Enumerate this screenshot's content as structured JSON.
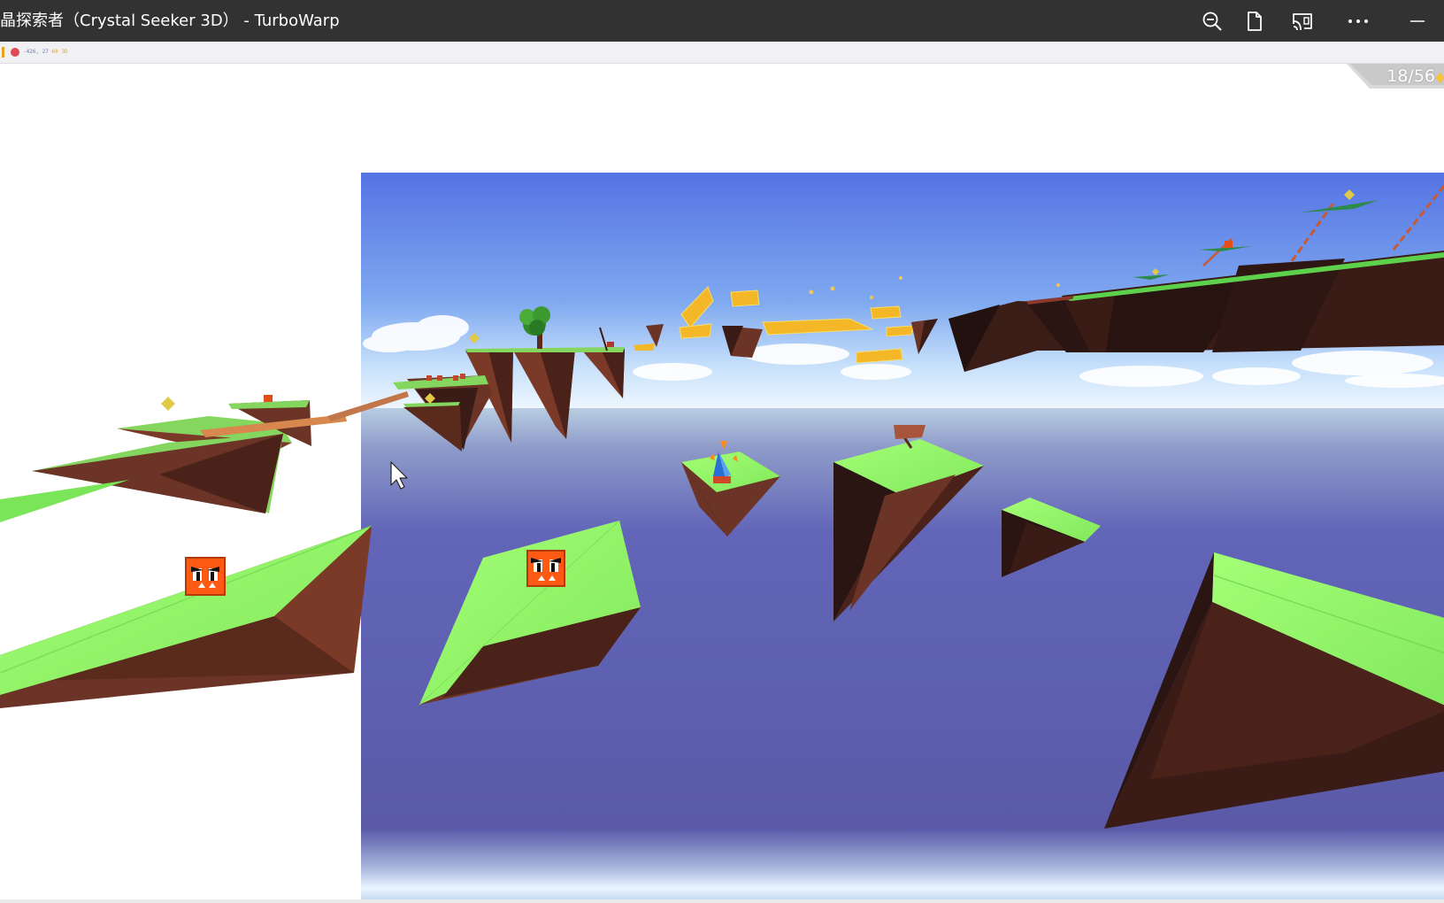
{
  "window": {
    "title": "晶探索者（Crystal Seeker 3D） - TurboWarp",
    "buttons": [
      "zoom-out-icon",
      "page-icon",
      "cast-icon",
      "more-icon",
      "minimize-icon"
    ]
  },
  "toolbar": {
    "readout_a": "-426, 27",
    "readout_b": "60 ",
    "readout_c": "3D"
  },
  "hud": {
    "crystal_counter": "18/56"
  },
  "colors": {
    "titlebar": "#323232",
    "sky_top": "#5576e0",
    "sky_horizon": "#e8f3ff",
    "sea": "#5d5fb3",
    "grass": "#9bf56c",
    "rock": "#6b3426",
    "rock_dark": "#2a1512",
    "crystal": "#f5c23a",
    "enemy": "#ff5a14",
    "accent": "#e7a21f"
  }
}
